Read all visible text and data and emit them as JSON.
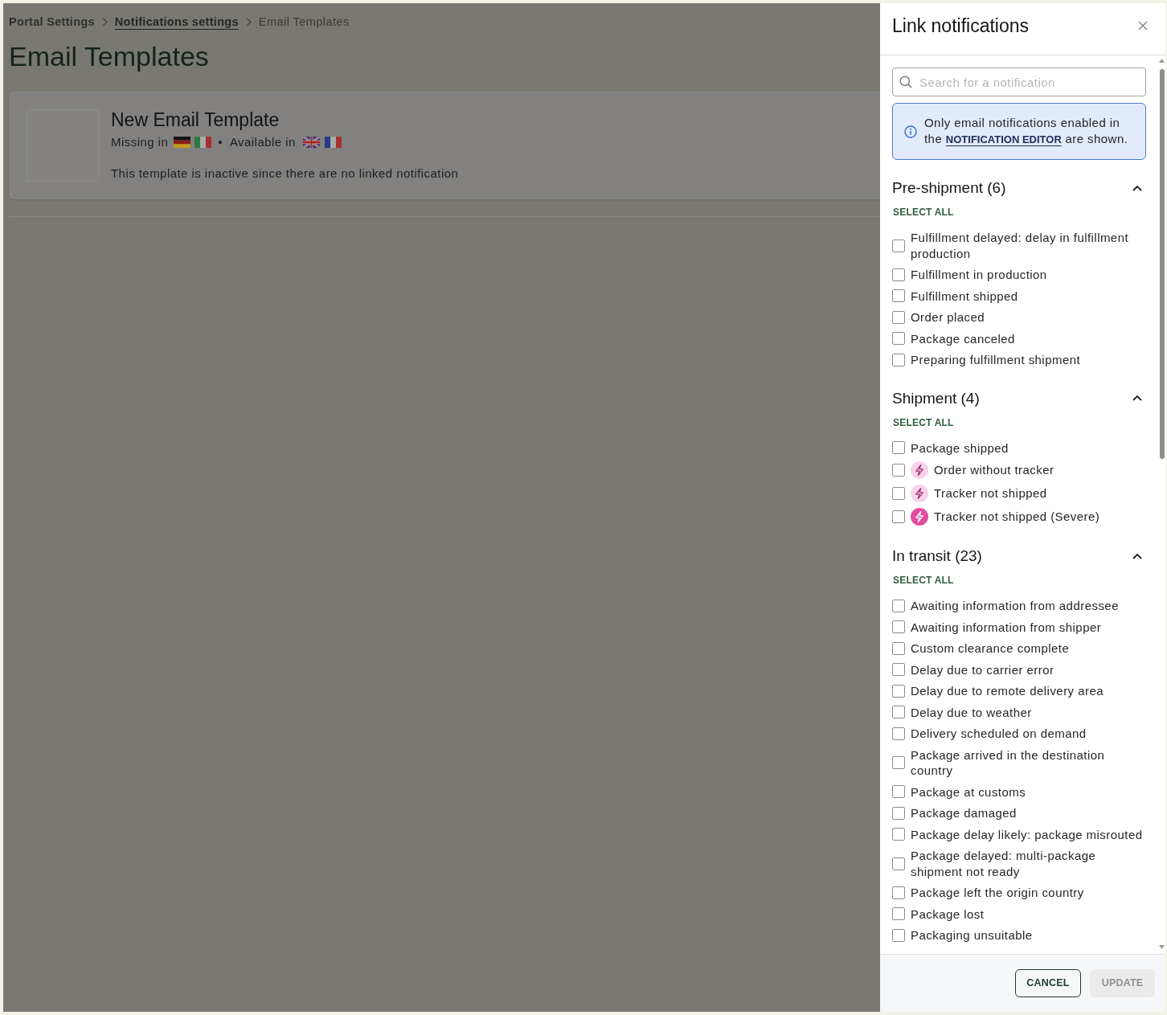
{
  "breadcrumb": [
    {
      "label": "Portal Settings",
      "kind": "parent"
    },
    {
      "label": "Notifications settings",
      "kind": "link"
    },
    {
      "label": "Email Templates",
      "kind": "current"
    }
  ],
  "page_title": "Email Templates",
  "template_card": {
    "title": "New Email Template",
    "missing_label": "Missing in",
    "missing_flags": [
      {
        "kind": "german"
      },
      {
        "kind": "italian"
      }
    ],
    "separator": "•",
    "available_label": "Available in",
    "available_flags": [
      {
        "kind": "british"
      },
      {
        "kind": "french"
      }
    ],
    "status_text": "This template is inactive since there are no linked notification"
  },
  "panel": {
    "title": "Link notifications",
    "search": {
      "placeholder": "Search for a notification"
    },
    "info": {
      "text_before": "Only email notifications enabled in the",
      "link": "NOTIFICATION EDITOR",
      "text_after": "are shown."
    },
    "sections": [
      {
        "title": "Pre-shipment (6)",
        "expanded": true,
        "select_all": "SELECT ALL",
        "items": [
          {
            "label": "Fulfillment delayed: delay in fulfillment production",
            "kind": "plain",
            "checked": false
          },
          {
            "label": "Fulfillment in production",
            "kind": "plain",
            "checked": false
          },
          {
            "label": "Fulfillment shipped",
            "kind": "plain",
            "checked": false
          },
          {
            "label": "Order placed",
            "kind": "plain",
            "checked": false
          },
          {
            "label": "Package canceled",
            "kind": "plain",
            "checked": false
          },
          {
            "label": "Preparing fulfillment shipment",
            "kind": "plain",
            "checked": false
          }
        ]
      },
      {
        "title": "Shipment (4)",
        "expanded": true,
        "select_all": "SELECT ALL",
        "items": [
          {
            "label": "Package shipped",
            "kind": "plain",
            "checked": false
          },
          {
            "label": "Order without tracker",
            "kind": "flash",
            "checked": false
          },
          {
            "label": "Tracker not shipped",
            "kind": "flash",
            "checked": false
          },
          {
            "label": "Tracker not shipped (Severe)",
            "kind": "severe",
            "checked": false
          }
        ]
      },
      {
        "title": "In transit (23)",
        "expanded": true,
        "select_all": "SELECT ALL",
        "items": [
          {
            "label": "Awaiting information from addressee",
            "kind": "plain",
            "checked": false
          },
          {
            "label": "Awaiting information from shipper",
            "kind": "plain",
            "checked": false
          },
          {
            "label": "Custom clearance complete",
            "kind": "plain",
            "checked": false
          },
          {
            "label": "Delay due to carrier error",
            "kind": "plain",
            "checked": false
          },
          {
            "label": "Delay due to remote delivery area",
            "kind": "plain",
            "checked": false
          },
          {
            "label": "Delay due to weather",
            "kind": "plain",
            "checked": false
          },
          {
            "label": "Delivery scheduled on demand",
            "kind": "plain",
            "checked": false
          },
          {
            "label": "Package arrived in the destination country",
            "kind": "plain",
            "checked": false
          },
          {
            "label": "Package at customs",
            "kind": "plain",
            "checked": false
          },
          {
            "label": "Package damaged",
            "kind": "plain",
            "checked": false
          },
          {
            "label": "Package delay likely: package misrouted",
            "kind": "plain",
            "checked": false
          },
          {
            "label": "Package delayed: multi-package shipment not ready",
            "kind": "plain",
            "checked": false
          },
          {
            "label": "Package left the origin country",
            "kind": "plain",
            "checked": false
          },
          {
            "label": "Package lost",
            "kind": "plain",
            "checked": false
          },
          {
            "label": "Packaging unsuitable",
            "kind": "plain",
            "checked": false
          }
        ]
      }
    ],
    "buttons": [
      {
        "label": "CANCEL",
        "kind": "outline",
        "disabled": false
      },
      {
        "label": "UPDATE",
        "kind": "filled",
        "disabled": true
      }
    ]
  }
}
